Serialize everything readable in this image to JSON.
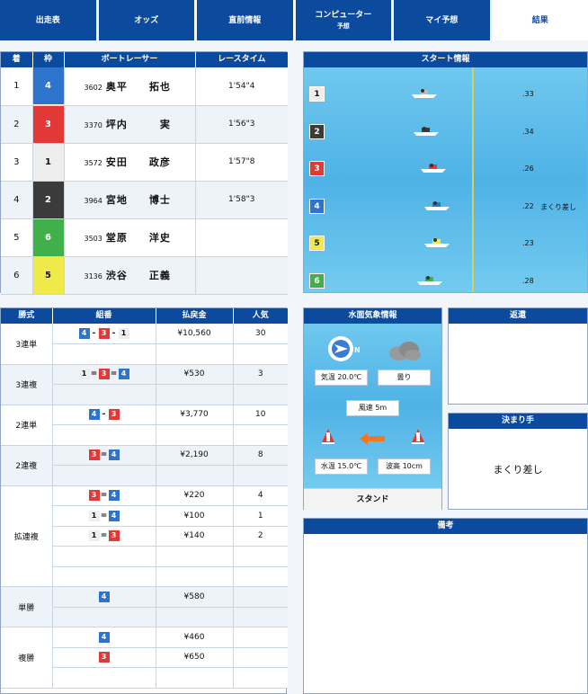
{
  "tabs": [
    {
      "label": "出走表",
      "sub": ""
    },
    {
      "label": "オッズ",
      "sub": ""
    },
    {
      "label": "直前情報",
      "sub": ""
    },
    {
      "label": "コンピューター",
      "sub": "予想"
    },
    {
      "label": "マイ予想",
      "sub": ""
    },
    {
      "label": "結果",
      "sub": ""
    }
  ],
  "results": {
    "headers": [
      "着",
      "枠",
      "ボートレーサー",
      "レースタイム"
    ],
    "rows": [
      {
        "rank": "1",
        "waku": "4",
        "id": "3602",
        "name": "奥平　　拓也",
        "time": "1'54\"4",
        "color": "#2f74cc",
        "text": "#fff"
      },
      {
        "rank": "2",
        "waku": "3",
        "id": "3370",
        "name": "坪内　　　実",
        "time": "1'56\"3",
        "color": "#e23838",
        "text": "#fff"
      },
      {
        "rank": "3",
        "waku": "1",
        "id": "3572",
        "name": "安田　　政彦",
        "time": "1'57\"8",
        "color": "#eeeeee",
        "text": "#111"
      },
      {
        "rank": "4",
        "waku": "2",
        "id": "3964",
        "name": "宮地　　博士",
        "time": "1'58\"3",
        "color": "#3b3b3b",
        "text": "#fff"
      },
      {
        "rank": "5",
        "waku": "6",
        "id": "3503",
        "name": "堂原　　洋史",
        "time": "",
        "color": "#3fb04a",
        "text": "#fff"
      },
      {
        "rank": "6",
        "waku": "5",
        "id": "3136",
        "name": "渋谷　　正義",
        "time": "",
        "color": "#f0e94a",
        "text": "#111"
      }
    ]
  },
  "start": {
    "title": "スタート情報",
    "lanes": [
      {
        "lane": "1",
        "st": ".33",
        "note": "",
        "color": "#eeeeee",
        "text": "#111"
      },
      {
        "lane": "2",
        "st": ".34",
        "note": "",
        "color": "#3b3b3b",
        "text": "#fff"
      },
      {
        "lane": "3",
        "st": ".26",
        "note": "",
        "color": "#e23838",
        "text": "#fff"
      },
      {
        "lane": "4",
        "st": ".22",
        "note": "まくり差し",
        "color": "#2f74cc",
        "text": "#fff"
      },
      {
        "lane": "5",
        "st": ".23",
        "note": "",
        "color": "#f0e94a",
        "text": "#111"
      },
      {
        "lane": "6",
        "st": ".28",
        "note": "",
        "color": "#3fb04a",
        "text": "#fff"
      }
    ]
  },
  "payout": {
    "headers": [
      "勝式",
      "組番",
      "払戻金",
      "人気"
    ],
    "groups": [
      {
        "type": "3連単",
        "rows": [
          {
            "combo": [
              "4",
              "-",
              "3",
              "-",
              "1"
            ],
            "amount": "¥10,560",
            "pop": "30"
          }
        ],
        "blank": 1
      },
      {
        "type": "3連複",
        "rows": [
          {
            "combo": [
              "1",
              "=",
              "3",
              "=",
              "4"
            ],
            "amount": "¥530",
            "pop": "3"
          }
        ],
        "blank": 1
      },
      {
        "type": "2連単",
        "rows": [
          {
            "combo": [
              "4",
              "-",
              "3"
            ],
            "amount": "¥3,770",
            "pop": "10"
          }
        ],
        "blank": 1
      },
      {
        "type": "2連複",
        "rows": [
          {
            "combo": [
              "3",
              "=",
              "4"
            ],
            "amount": "¥2,190",
            "pop": "8"
          }
        ],
        "blank": 1
      },
      {
        "type": "拡連複",
        "rows": [
          {
            "combo": [
              "3",
              "=",
              "4"
            ],
            "amount": "¥220",
            "pop": "4"
          },
          {
            "combo": [
              "1",
              "=",
              "4"
            ],
            "amount": "¥100",
            "pop": "1"
          },
          {
            "combo": [
              "1",
              "=",
              "3"
            ],
            "amount": "¥140",
            "pop": "2"
          }
        ],
        "blank": 2
      },
      {
        "type": "単勝",
        "rows": [
          {
            "combo": [
              "4"
            ],
            "amount": "¥580",
            "pop": ""
          }
        ],
        "blank": 1
      },
      {
        "type": "複勝",
        "rows": [
          {
            "combo": [
              "4"
            ],
            "amount": "¥460",
            "pop": ""
          },
          {
            "combo": [
              "3"
            ],
            "amount": "¥650",
            "pop": ""
          }
        ],
        "blank": 1
      }
    ]
  },
  "weather": {
    "title": "水面気象情報",
    "wind_dir_label": "N",
    "air_temp": "気温 20.0℃",
    "condition": "曇り",
    "wind_speed": "風速 5m",
    "water_temp": "水温 15.0℃",
    "wave": "波高 10cm",
    "stand": "スタンド"
  },
  "henkan": {
    "title": "返還"
  },
  "kimarite": {
    "title": "決まり手",
    "value": "まくり差し"
  },
  "biko": {
    "title": "備考"
  },
  "colors": {
    "1": "#eeeeee",
    "2": "#3b3b3b",
    "3": "#e23838",
    "4": "#2f74cc",
    "5": "#f0e94a",
    "6": "#3fb04a",
    "primary": "#0c4a9e"
  }
}
